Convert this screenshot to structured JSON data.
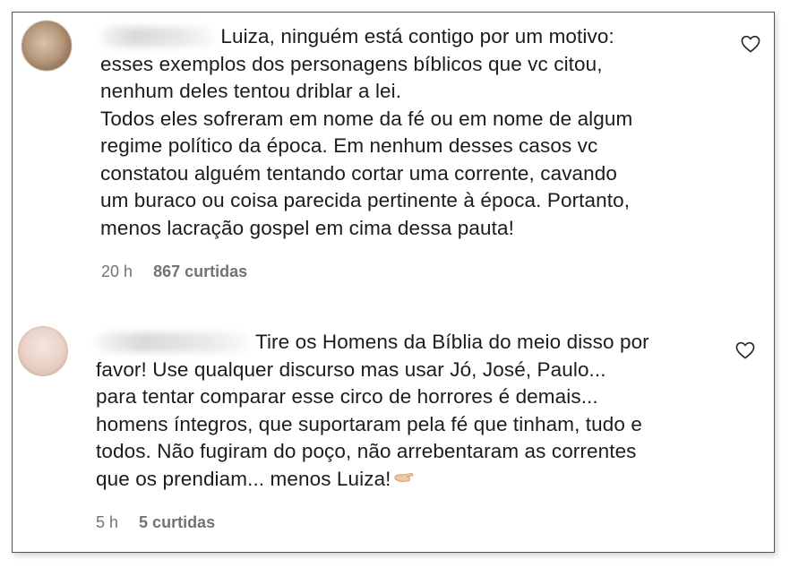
{
  "comments": [
    {
      "body_lines": [
        "Luiza, ninguém está contigo por um motivo:",
        "esses exemplos dos personagens bíblicos que vc citou,",
        "nenhum deles tentou driblar a lei.",
        "Todos eles sofreram em nome da fé ou em nome de algum",
        "regime político da época. Em nenhum desses casos vc",
        "constatou alguém tentando cortar uma corrente, cavando",
        "um buraco ou coisa parecida pertinente à época. Portanto,",
        "menos lacração gospel em cima dessa pauta!"
      ],
      "time": "20 h",
      "likes": "867 curtidas",
      "like_icon": "heart-outline-icon"
    },
    {
      "body_lines": [
        "Tire os Homens da Bíblia do meio disso por",
        "favor! Use qualquer discurso mas usar Jó, José, Paulo...",
        "para tentar comparar esse circo de horrores é demais...",
        "homens íntegros, que suportaram pela fé que tinham, tudo e",
        "todos. Não fugiram do poço, não arrebentaram as correntes",
        "que os prendiam... menos Luiza!"
      ],
      "time": "5 h",
      "likes": "5 curtidas",
      "like_icon": "heart-outline-icon",
      "trailing_emoji": "backhand-index-pointing-left-emoji"
    }
  ]
}
